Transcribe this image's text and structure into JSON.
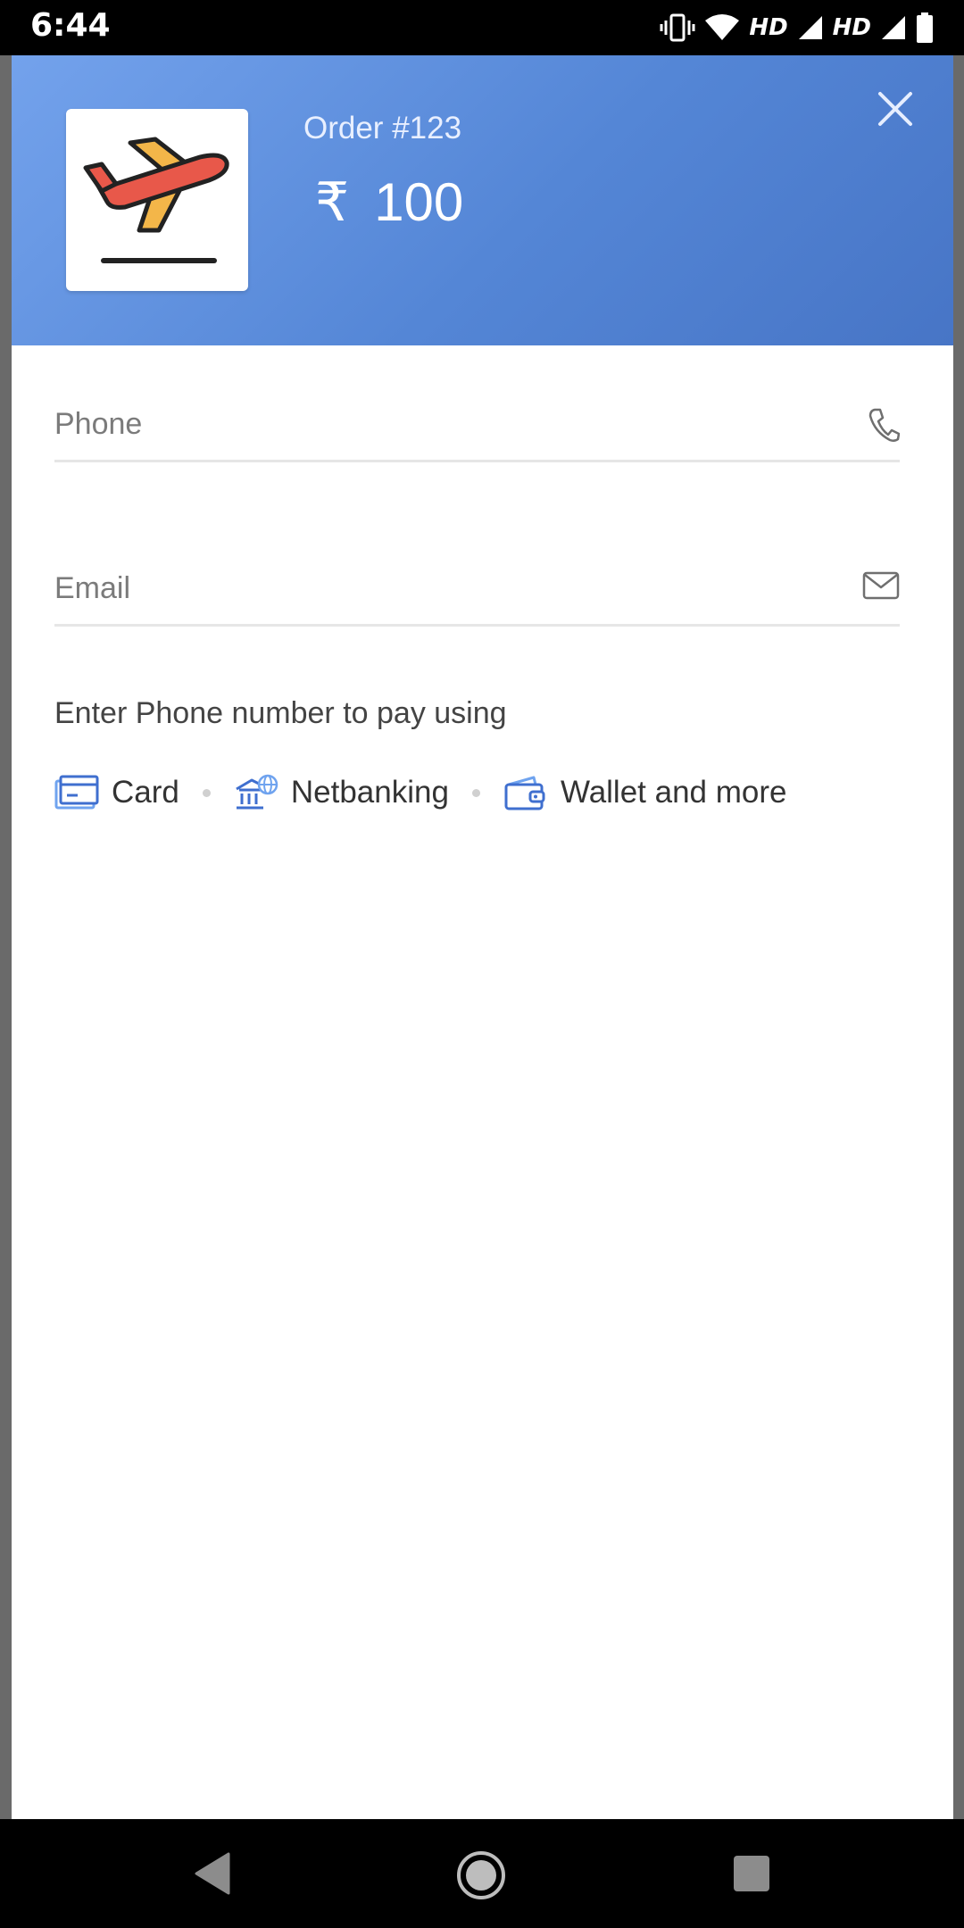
{
  "status_bar": {
    "time": "6:44",
    "network_label_1": "HD",
    "network_label_2": "HD"
  },
  "header": {
    "order_label": "Order #123",
    "currency_symbol": "₹",
    "amount": "100",
    "logo_icon": "airplane-takeoff-icon",
    "close_icon": "close-icon"
  },
  "form": {
    "phone": {
      "value": "",
      "placeholder": "Phone",
      "icon": "phone-icon"
    },
    "email": {
      "value": "",
      "placeholder": "Email",
      "icon": "mail-icon"
    }
  },
  "payment": {
    "hint": "Enter Phone number to pay using",
    "methods": [
      {
        "label": "Card",
        "icon": "card-icon"
      },
      {
        "label": "Netbanking",
        "icon": "bank-icon"
      },
      {
        "label": "Wallet and more",
        "icon": "wallet-icon"
      }
    ]
  },
  "colors": {
    "header_gradient_start": "#73a2ec",
    "header_gradient_end": "#4775c6",
    "accent_blue": "#3f6fcf",
    "plane_red": "#e8584a",
    "plane_yellow": "#f3b649"
  },
  "nav_bar": {
    "back_icon": "back-triangle-icon",
    "home_icon": "home-circle-icon",
    "recent_icon": "recent-apps-icon"
  }
}
